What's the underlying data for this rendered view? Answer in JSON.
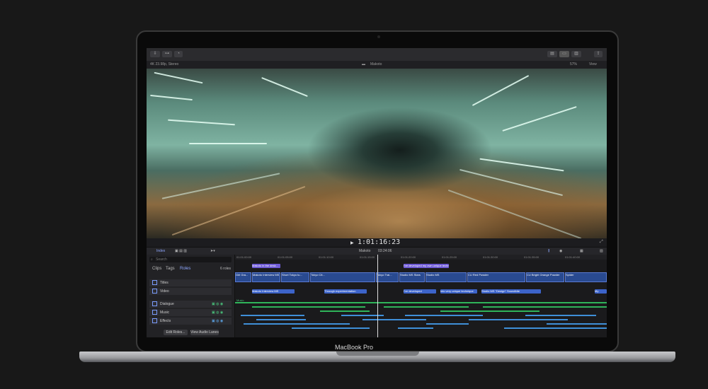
{
  "device": {
    "brand_label": "MacBook Pro"
  },
  "viewer": {
    "format_info": "4K 23.98p, Stereo",
    "project_name": "Makoto",
    "zoom": "57%",
    "view_menu": "View"
  },
  "transport": {
    "timecode": "1:01:16:23"
  },
  "timeline_header": {
    "index_label": "Index",
    "project_label": "Makoto",
    "duration": "03:24:06"
  },
  "ruler_ticks": [
    "01:01:00:00",
    "01:01:05:00",
    "01:01:10:00",
    "01:01:15:00",
    "01:01:20:00",
    "01:01:25:00",
    "01:01:30:00",
    "01:01:35:00",
    "01:01:40:00"
  ],
  "index_panel": {
    "search_placeholder": "Search",
    "tabs": [
      "Clips",
      "Tags",
      "Roles"
    ],
    "role_count": "6 roles",
    "roles": [
      "Titles",
      "Video",
      "Dialogue",
      "Music",
      "Effects"
    ],
    "edit_roles_button": "Edit Roles...",
    "audio_lanes_button": "View Audio Lanes"
  },
  "timeline": {
    "title_clips": [
      "Makoto in the desk...",
      "I've developed my own unique techniques..."
    ],
    "video_clips": [
      "Girl Gra...",
      "Makoto Interview MS",
      "Short Tokyo tu...",
      "Tokyo Cit...",
      "Tokyo Trai...",
      "Studio MS Stars",
      "Studio MS",
      "CU Red Powder",
      "CU Bright Orange Powder",
      "Spider"
    ],
    "audio_clips": [
      "Makoto Interview MS",
      "Through experimentation",
      "I've developed",
      "into very unique technique",
      "Studio MS \"Design\" Soundbite",
      "My"
    ],
    "music_label": "Music"
  }
}
